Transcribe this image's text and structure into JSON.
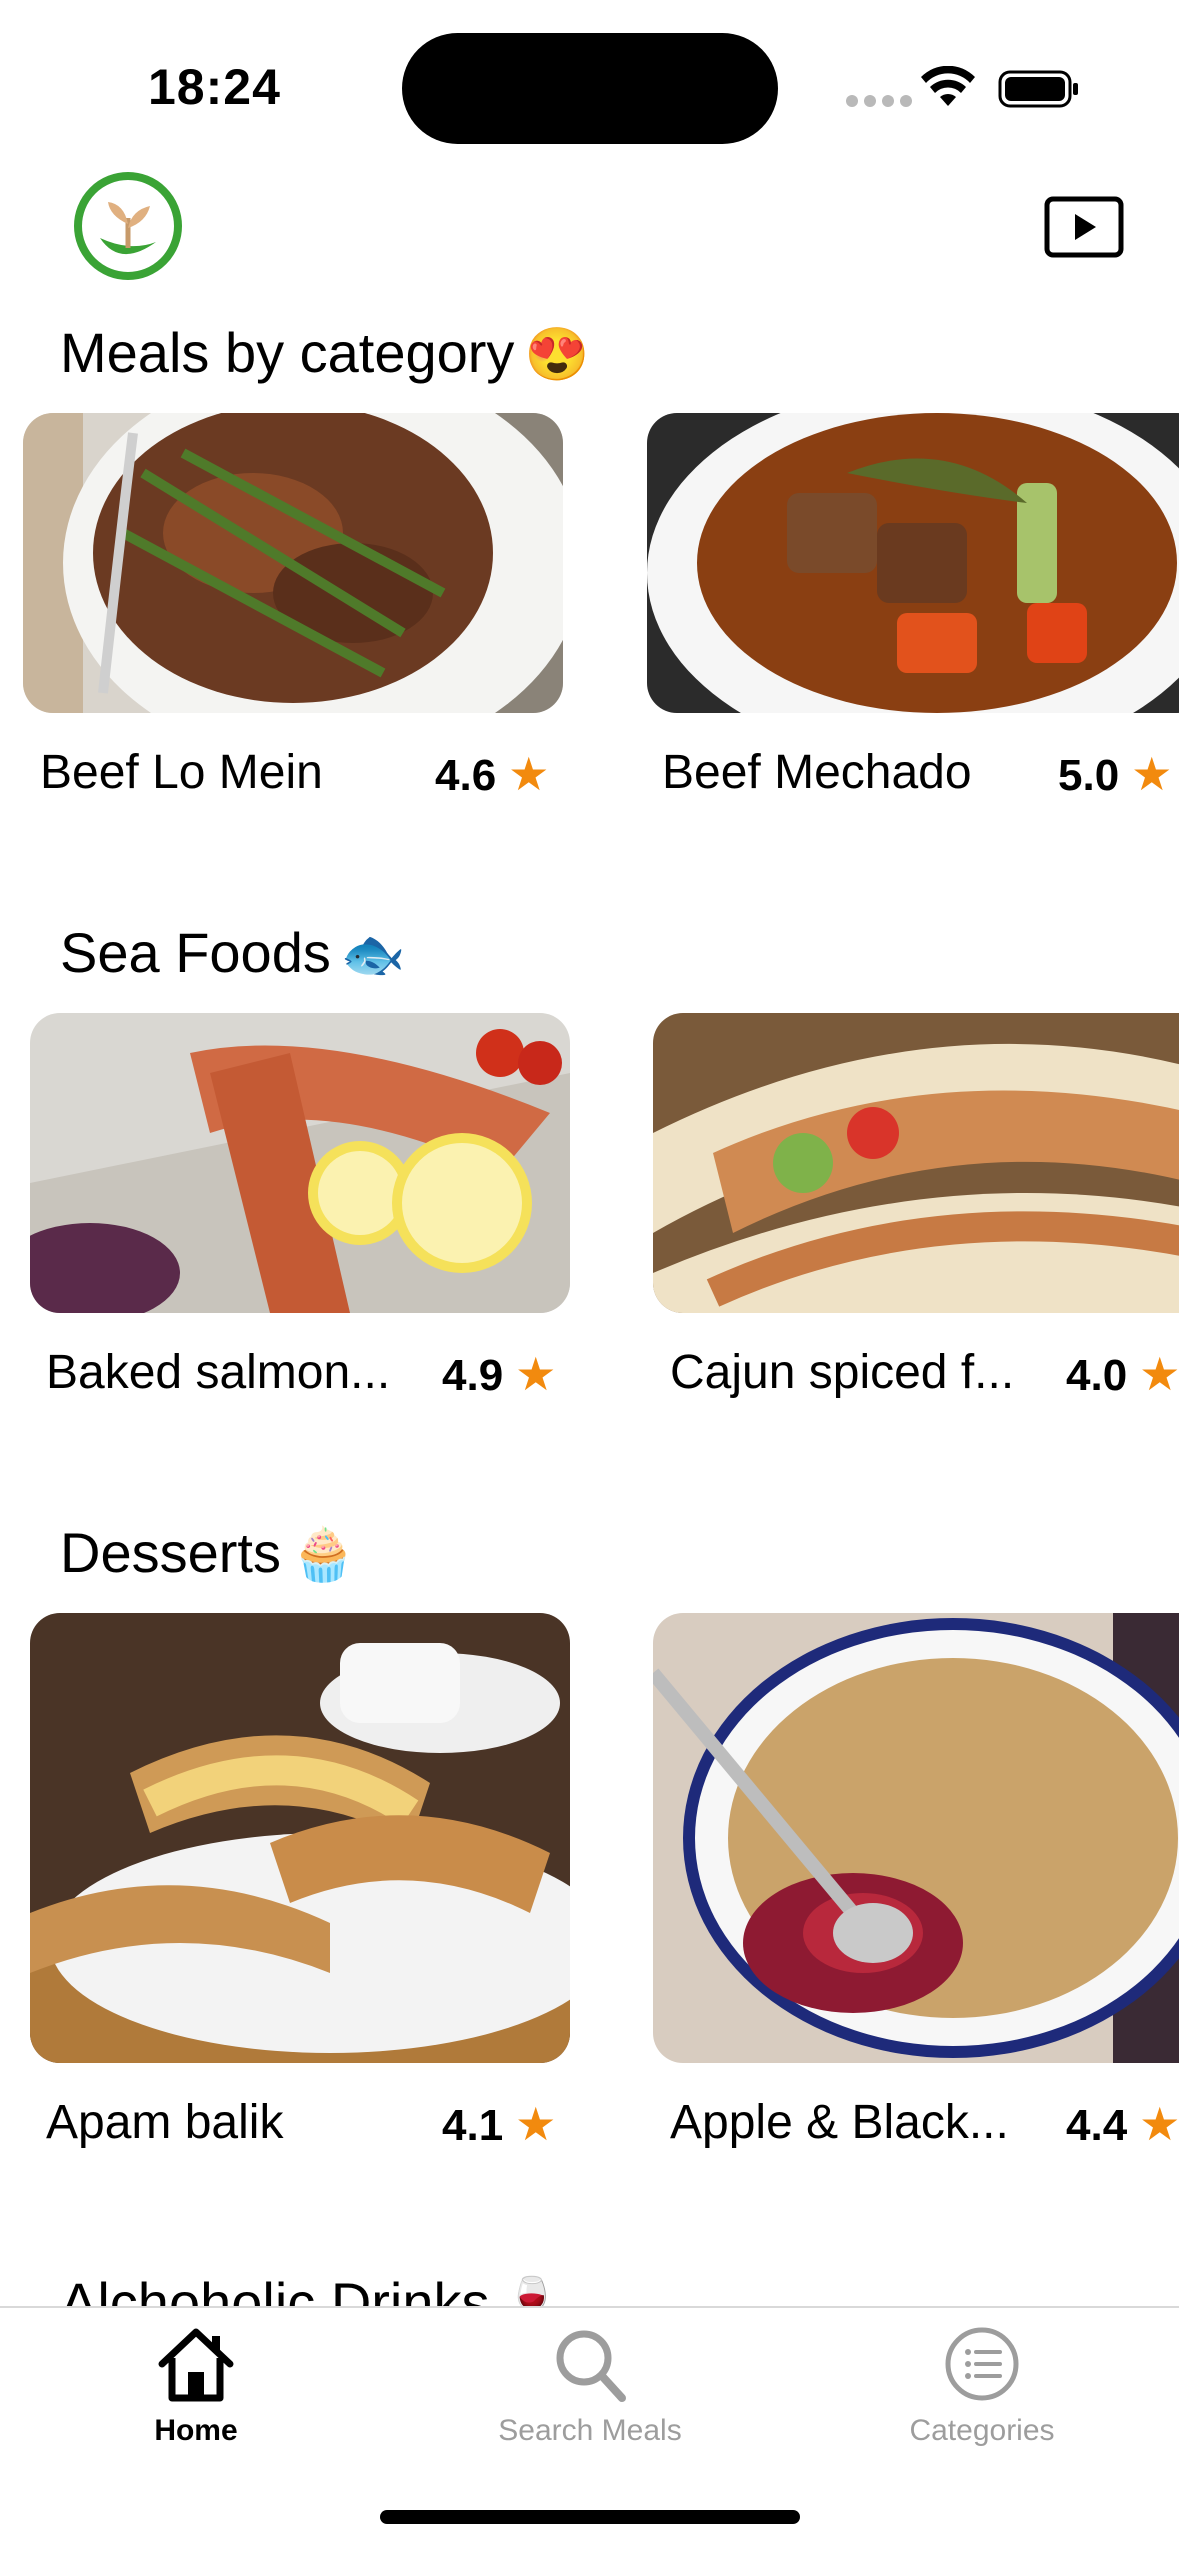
{
  "status_bar": {
    "time": "18:24"
  },
  "sections": [
    {
      "title": "Meals by category",
      "emoji": "😍",
      "items": [
        {
          "name": "Beef Lo Mein",
          "rating": "4.6"
        },
        {
          "name": "Beef Mechado",
          "rating": "5.0"
        }
      ]
    },
    {
      "title": "Sea Foods",
      "emoji": "🐟",
      "items": [
        {
          "name": "Baked salmon...",
          "rating": "4.9"
        },
        {
          "name": "Cajun spiced f...",
          "rating": "4.0"
        }
      ]
    },
    {
      "title": "Desserts",
      "emoji": "🧁",
      "items": [
        {
          "name": "Apam balik",
          "rating": "4.1"
        },
        {
          "name": "Apple & Black...",
          "rating": "4.4"
        }
      ]
    },
    {
      "title": "Alchoholic Drinks",
      "emoji": "🍷",
      "items": []
    }
  ],
  "tabs": [
    {
      "label": "Home",
      "icon": "home-icon",
      "active": true
    },
    {
      "label": "Search Meals",
      "icon": "search-icon",
      "active": false
    },
    {
      "label": "Categories",
      "icon": "list-icon",
      "active": false
    }
  ],
  "colors": {
    "star": "#f28a0e",
    "logo_green": "#3aa335",
    "inactive_tab": "#9d9d9d"
  }
}
